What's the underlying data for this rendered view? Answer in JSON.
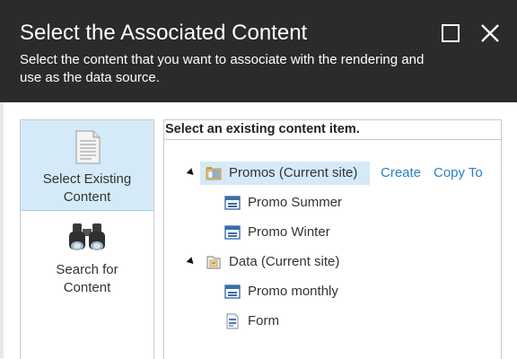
{
  "dialog": {
    "title": "Select the Associated Content",
    "subtitle": "Select the content that you want to associate with the rendering and use as the data source."
  },
  "nav": {
    "items": [
      {
        "label_line1": "Select Existing",
        "label_line2": "Content",
        "selected": true,
        "icon": "document-icon"
      },
      {
        "label_line1": "Search for",
        "label_line2": "Content",
        "selected": false,
        "icon": "binoculars-icon"
      }
    ]
  },
  "tree": {
    "header": "Select an existing content item.",
    "nodes": [
      {
        "label": "Promos (Current site)",
        "icon": "folder-icon",
        "expanded": true,
        "selected": true
      },
      {
        "label": "Promo Summer",
        "icon": "promo-template-icon"
      },
      {
        "label": "Promo Winter",
        "icon": "promo-template-icon"
      },
      {
        "label": "Data (Current site)",
        "icon": "data-folder-icon",
        "expanded": true
      },
      {
        "label": "Promo monthly",
        "icon": "promo-template-icon"
      },
      {
        "label": "Form",
        "icon": "form-icon"
      }
    ],
    "actions": {
      "create": "Create",
      "copy_to": "Copy To"
    }
  },
  "colors": {
    "header_bg": "#2b2b2b",
    "selected_bg": "#d5eaf8",
    "link": "#2e7fc0"
  }
}
